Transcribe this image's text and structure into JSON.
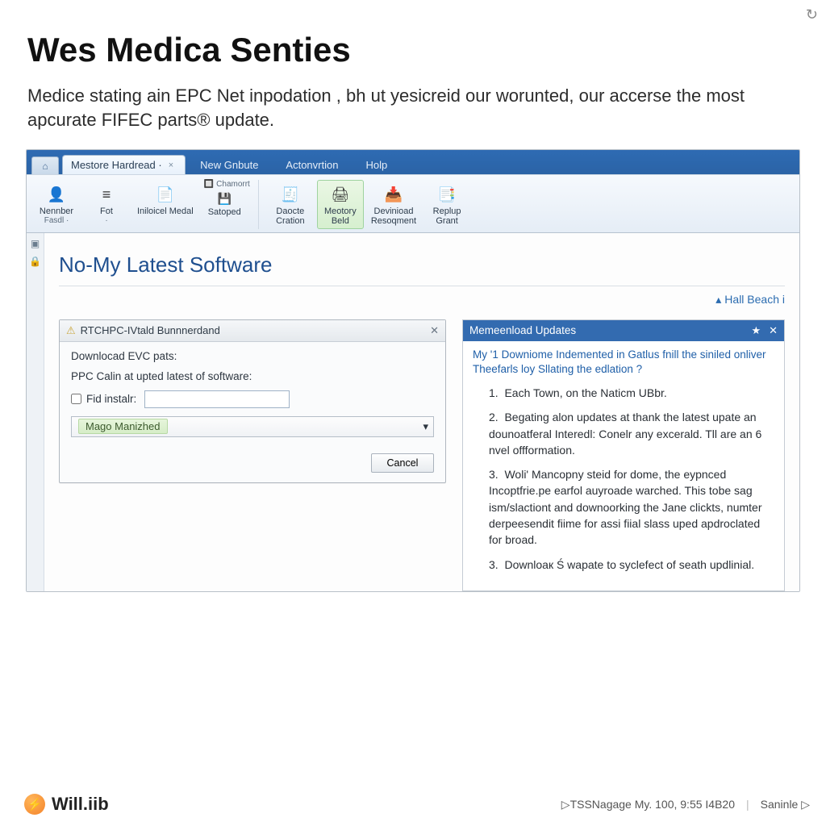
{
  "top": {
    "refresh_glyph": "↻"
  },
  "page": {
    "title": "Wes Medica Senties",
    "subtitle": "Medice stating ain EPC Net inpodation , bh ut yesicreid our worunted, our accerse the most apcurate FIFEC parts® update."
  },
  "titlebar": {
    "active_tab": "Mestore Hardread ·",
    "tabs": [
      "New Gnbute",
      "Actonvrtion",
      "Holp"
    ]
  },
  "ribbon": {
    "chamorrt_label": "Chamorrt",
    "buttons": [
      {
        "icon": "👤",
        "line1": "Nennber",
        "line2": "Fasdl ·"
      },
      {
        "icon": "≡",
        "line1": "Fot",
        "line2": "·"
      },
      {
        "icon": "📄",
        "line1": "Iniloicel Medal",
        "line2": ""
      },
      {
        "icon": "💾",
        "line1": "Satoped",
        "line2": ""
      },
      {
        "icon": "🧾",
        "line1": "Daocte",
        "line2": "Cration"
      },
      {
        "icon": "🖨",
        "line1": "Meotory",
        "line2": "Beld",
        "highlight": true
      },
      {
        "icon": "📥",
        "line1": "Devinioad",
        "line2": "Resoqment"
      },
      {
        "icon": "📑",
        "line1": "Replup",
        "line2": "Grant"
      }
    ]
  },
  "doc": {
    "heading": "No-My Latest Software",
    "breadcrumb_caret": "▴",
    "breadcrumb": "Hall Beach i"
  },
  "dialog": {
    "title": "RTCHPC-IVtald Bunnnerdand",
    "close_glyph": "✕",
    "line1": "Downlocad EVC pats:",
    "line2": "PPC Calin at upted latest of software:",
    "checkbox_label": "Fid instalr:",
    "input_value": "",
    "select_value": "Mago Manizhed",
    "select_caret": "▾",
    "cancel": "Cancel"
  },
  "updates": {
    "title": "Memeenload Updates",
    "star_glyph": "★",
    "close_glyph": "✕",
    "lead": "My '1 Downiome Indemented in Gatlus fnill the siniled onliver Theefarls loy Sllating the edlation ?",
    "items": [
      "Each Town, on the Naticm UBbr.",
      "Begating alon updates at thank the latest upate an dounoatferal Interedl: Conelr any excerald. Tll are an 6 nvel offformation.",
      "Woli' Mancopny steid for dome, the eypnced Incoptfrie.pe earfol auyroade warched. This tobe sag ism/slactiont and downoorking the Jane clickts, numter derpeesendit fiime for assi fiial slass uped apdroclated for broad.",
      "Downloaк Ś wapate to syclefect of seath updlinial."
    ],
    "numbers": [
      "1.",
      "2.",
      "3.",
      "3."
    ]
  },
  "footer": {
    "brand": "Will.iib",
    "status": "▷TSSNagage My. 100,  9:55 I4B20",
    "right_link": "Saninle ▷"
  }
}
